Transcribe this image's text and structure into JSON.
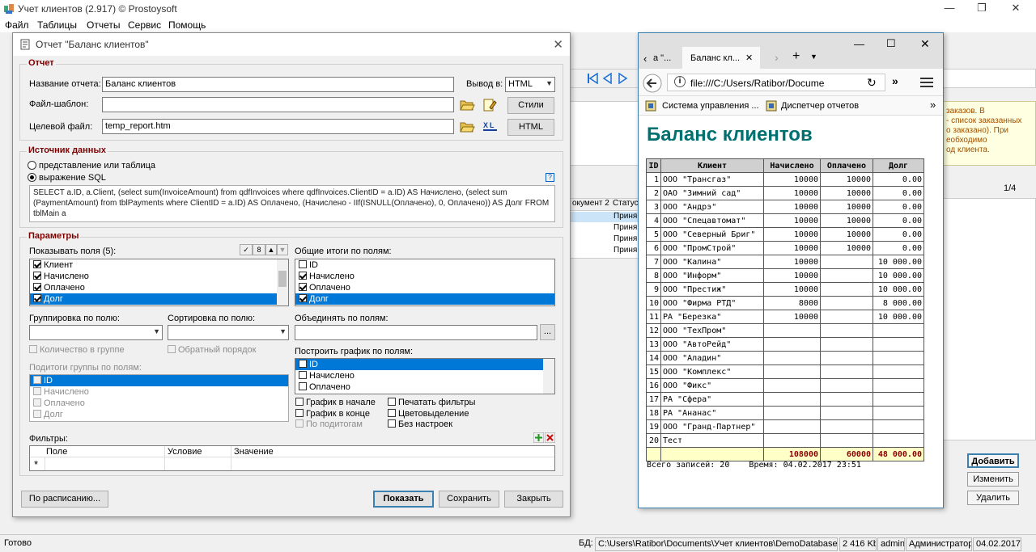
{
  "app": {
    "title": "Учет клиентов (2.917) © Prostoysoft",
    "menu": [
      "Файл",
      "Таблицы",
      "Отчеты",
      "Сервис",
      "Помощь"
    ],
    "status": {
      "ready": "Готово",
      "db_label": "БД:",
      "db_path": "C:\\Users\\Ratibor\\Documents\\Учет клиентов\\DemoDatabase.mdb",
      "size": "2 416 Kb",
      "user": "admin",
      "role": "Администратор",
      "date": "04.02.2017"
    },
    "bg_hint": "заказов. В\n- список заказанных\nо заказано). При\nеобходимо\nод клиента.",
    "bg_page": "1/4",
    "bg_cols": [
      "окумент 2",
      "Статус"
    ],
    "bg_rows": [
      "Приня",
      "Приня",
      "Приня",
      "Приня"
    ],
    "bg_buttons": [
      "Добавить",
      "Изменить",
      "Удалить"
    ]
  },
  "dialog": {
    "title": "Отчет \"Баланс клиентов\"",
    "report_group": "Отчет",
    "name_label": "Название отчета:",
    "name_value": "Баланс клиентов",
    "output_label": "Вывод в:",
    "output_value": "HTML",
    "template_label": "Файл-шаблон:",
    "template_value": "",
    "styles_button": "Стили",
    "target_label": "Целевой файл:",
    "target_value": "temp_report.htm",
    "html_button": "HTML",
    "source_group": "Источник данных",
    "radio_view": "представление или таблица",
    "radio_sql": "выражение SQL",
    "help_icon_text": "?",
    "sql": "SELECT a.ID, a.Client, (select sum(InvoiceAmount) from qdfInvoices where qdfInvoices.ClientID = a.ID) AS Начислено, (select sum (PaymentAmount) from tblPayments where ClientID = a.ID) AS Оплачено, (Начислено - IIf(ISNULL(Оплачено), 0, Оплачено)) AS Долг FROM tblMain a",
    "params_group": "Параметры",
    "show_fields_label": "Показывать поля (5):",
    "show_fields": [
      {
        "label": "Клиент",
        "checked": true,
        "selected": false
      },
      {
        "label": "Начислено",
        "checked": true,
        "selected": false
      },
      {
        "label": "Оплачено",
        "checked": true,
        "selected": false
      },
      {
        "label": "Долг",
        "checked": true,
        "selected": true
      }
    ],
    "totals_label": "Общие итоги по полям:",
    "totals_fields": [
      {
        "label": "ID",
        "checked": false,
        "selected": false
      },
      {
        "label": "Начислено",
        "checked": true,
        "selected": false
      },
      {
        "label": "Оплачено",
        "checked": true,
        "selected": false
      },
      {
        "label": "Долг",
        "checked": true,
        "selected": true
      }
    ],
    "group_by_label": "Группировка по полю:",
    "sort_by_label": "Сортировка по полю:",
    "merge_label": "Объединять по полям:",
    "merge_button": "...",
    "count_in_group": "Количество в группе",
    "reverse_order": "Обратный порядок",
    "group_subtotals_label": "Подитоги группы по полям:",
    "group_subtotals": [
      {
        "label": "ID",
        "selected": true
      },
      {
        "label": "Начислено",
        "selected": false
      },
      {
        "label": "Оплачено",
        "selected": false
      },
      {
        "label": "Долг",
        "selected": false
      }
    ],
    "chart_label": "Построить график по полям:",
    "chart_fields": [
      {
        "label": "ID",
        "selected": true
      },
      {
        "label": "Начислено",
        "selected": false
      },
      {
        "label": "Оплачено",
        "selected": false
      }
    ],
    "chart_start": "График в начале",
    "chart_end": "График в конце",
    "by_subtotals": "По подитогам",
    "print_filters": "Печатать фильтры",
    "color_highlight": "Цветовыделение",
    "no_settings": "Без настроек",
    "filters_label": "Фильтры:",
    "filter_cols": [
      "Поле",
      "Условие",
      "Значение"
    ],
    "filter_newrow": "*",
    "schedule_button": "По расписанию...",
    "show_button": "Показать",
    "save_button": "Сохранить",
    "close_button": "Закрыть"
  },
  "browser": {
    "tab_prev": "а \"...",
    "tab_label": "Баланс кл...",
    "url": "file:///C:/Users/Ratibor/Docume",
    "bookmarks": [
      "Система управления ...",
      "Диспетчер отчетов"
    ],
    "report_title": "Баланс клиентов",
    "columns": [
      "ID",
      "Клиент",
      "Начислено",
      "Оплачено",
      "Долг"
    ],
    "rows": [
      [
        "1",
        "ООО \"Трансгаз\"",
        "10000",
        "10000",
        "0.00"
      ],
      [
        "2",
        "ОАО \"Зимний сад\"",
        "10000",
        "10000",
        "0.00"
      ],
      [
        "3",
        "ООО \"Андрэ\"",
        "10000",
        "10000",
        "0.00"
      ],
      [
        "4",
        "ООО \"Спецавтомат\"",
        "10000",
        "10000",
        "0.00"
      ],
      [
        "5",
        "ООО \"Северный Бриг\"",
        "10000",
        "10000",
        "0.00"
      ],
      [
        "6",
        "ООО \"ПромСтрой\"",
        "10000",
        "10000",
        "0.00"
      ],
      [
        "7",
        "ООО \"Калина\"",
        "10000",
        "",
        "10 000.00"
      ],
      [
        "8",
        "ООО \"Информ\"",
        "10000",
        "",
        "10 000.00"
      ],
      [
        "9",
        "ООО \"Престиж\"",
        "10000",
        "",
        "10 000.00"
      ],
      [
        "10",
        "ООО \"Фирма РТД\"",
        "8000",
        "",
        "8 000.00"
      ],
      [
        "11",
        "РА \"Березка\"",
        "10000",
        "",
        "10 000.00"
      ],
      [
        "12",
        "ООО \"ТехПром\"",
        "",
        "",
        ""
      ],
      [
        "13",
        "ООО \"АвтоРейд\"",
        "",
        "",
        ""
      ],
      [
        "14",
        "ООО \"Аладин\"",
        "",
        "",
        ""
      ],
      [
        "15",
        "ООО \"Комплекс\"",
        "",
        "",
        ""
      ],
      [
        "16",
        "ООО \"Фикс\"",
        "",
        "",
        ""
      ],
      [
        "17",
        "РА \"Сфера\"",
        "",
        "",
        ""
      ],
      [
        "18",
        "РА \"Ананас\"",
        "",
        "",
        ""
      ],
      [
        "19",
        "ООО \"Гранд-Партнер\"",
        "",
        "",
        ""
      ],
      [
        "20",
        "Тест",
        "",
        "",
        ""
      ]
    ],
    "totals": [
      "",
      "",
      "108000",
      "60000",
      "48 000.00"
    ],
    "footer": "Всего записей: 20    Время: 04.02.2017 23:51"
  }
}
